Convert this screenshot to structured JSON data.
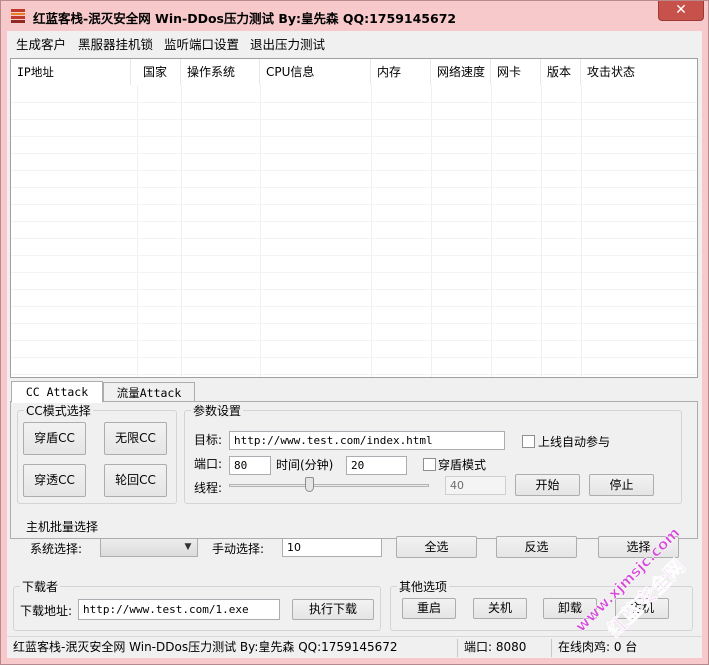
{
  "window": {
    "title": "红蓝客栈-泯灭安全网 Win-DDos压力测试   By:皇先森 QQ:1759145672",
    "close_glyph": "✕",
    "app_icon": "app-stack-icon"
  },
  "menu": [
    "生成客户",
    "黑服器挂机锁",
    "监听端口设置",
    "退出压力测试"
  ],
  "table": {
    "columns": [
      "IP地址",
      "国家",
      "操作系统",
      "CPU信息",
      "内存",
      "网络速度",
      "网卡",
      "版本",
      "攻击状态"
    ],
    "rows": []
  },
  "tabs": [
    "CC Attack",
    "流量Attack"
  ],
  "cc_mode": {
    "title": "CC模式选择",
    "buttons": [
      "穿盾CC",
      "无限CC",
      "穿透CC",
      "轮回CC"
    ]
  },
  "params": {
    "title": "参数设置",
    "target_label": "目标:",
    "target_value": "http://www.test.com/index.html",
    "auto_join_label": "上线自动参与",
    "port_label": "端口:",
    "port_value": "80",
    "time_label": "时间(分钟)",
    "time_value": "20",
    "shield_mode_label": "穿盾模式",
    "threads_label": "线程:",
    "threads_value": "40",
    "threads_slider_fraction": 0.4,
    "start_button": "开始",
    "stop_button": "停止"
  },
  "batch": {
    "title": "主机批量选择",
    "system_label": "系统选择:",
    "system_value": "",
    "manual_label": "手动选择:",
    "manual_value": "10",
    "select_all": "全选",
    "invert": "反选",
    "select": "选择"
  },
  "downloader": {
    "title": "下载者",
    "url_label": "下载地址:",
    "url_value": "http://www.test.com/1.exe",
    "execute_button": "执行下载"
  },
  "other": {
    "title": "其他选项",
    "buttons": [
      "重启",
      "关机",
      "卸载",
      "主机"
    ]
  },
  "status": {
    "left": "红蓝客栈-泯灭安全网 Win-DDos压力测试   By:皇先森 QQ:1759145672",
    "port": "端口: 8080",
    "online": "在线肉鸡: 0 台"
  },
  "watermark": {
    "line1": "www.xjmsjc.com",
    "line2": "红蓝安全网"
  },
  "colors": {
    "title_bg": "#f7c9cb",
    "close_bg": "#c7514b",
    "watermark": "#d64bd9"
  }
}
